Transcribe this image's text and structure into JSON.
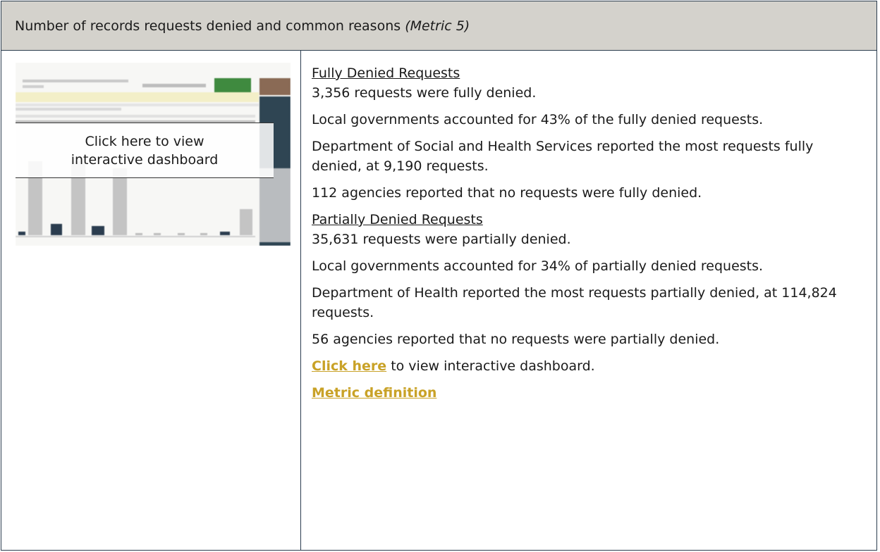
{
  "header": {
    "title": "Number of records requests denied and common reasons",
    "title_italic": "(Metric 5)"
  },
  "thumbnail": {
    "overlay_line1": "Click here to view",
    "overlay_line2": "interactive dashboard"
  },
  "fully_denied": {
    "heading": "Fully Denied Requests",
    "total": "3,356 requests were fully denied.",
    "local_share": "Local governments accounted for 43% of the fully denied requests.",
    "top_agency": "Department of Social and Health Services reported the most requests fully denied, at 9,190 requests.",
    "none_count": "112 agencies reported that no requests were fully denied."
  },
  "partially_denied": {
    "heading": "Partially Denied Requests",
    "total": "35,631 requests were partially denied.",
    "local_share": "Local governments accounted for 34% of partially denied requests.",
    "top_agency": "Department of Health reported the most requests partially denied, at 114,824 requests.",
    "none_count": "56 agencies reported that no requests were partially denied."
  },
  "links": {
    "click_here": "Click here",
    "click_here_suffix": " to view interactive dashboard.",
    "metric_definition": "Metric definition"
  },
  "colors": {
    "header_bg": "#d4d2cc",
    "border": "#2b3d4f",
    "link": "#c9a227"
  }
}
